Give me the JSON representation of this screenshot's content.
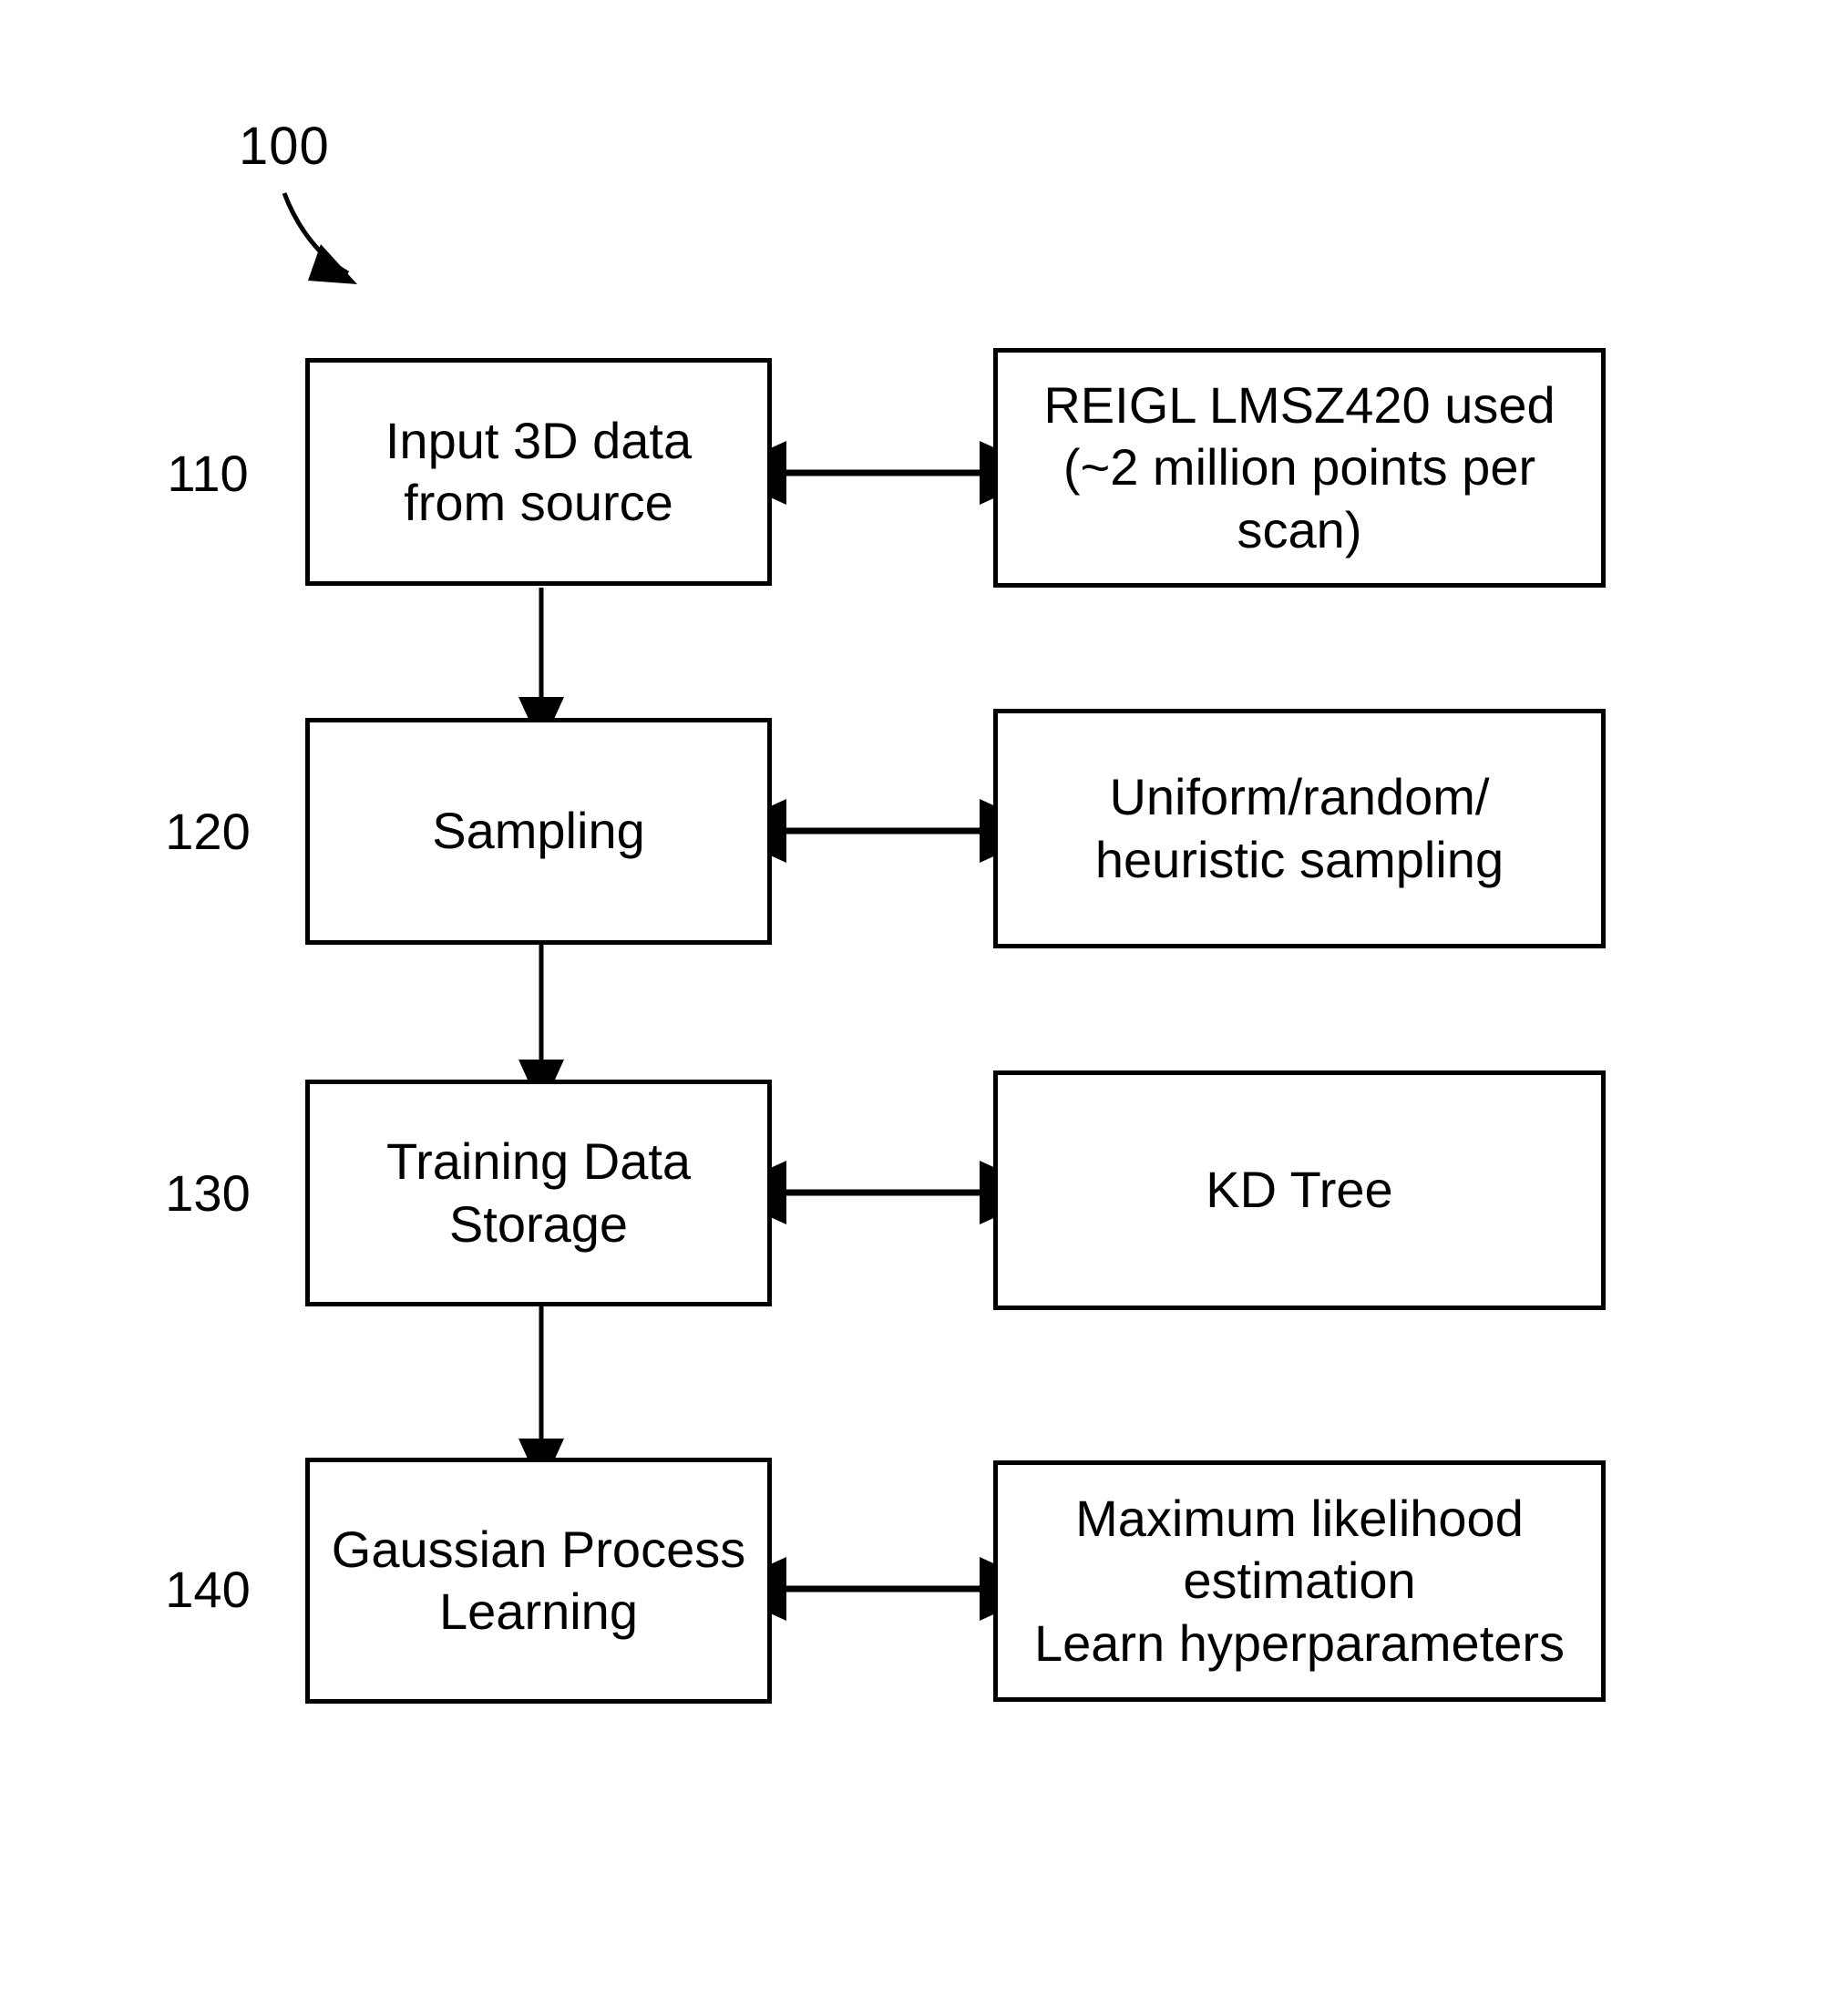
{
  "figure": {
    "reference_numeral": "100",
    "title": ""
  },
  "steps": [
    {
      "number": "110",
      "box_label": "Input 3D data\nfrom source",
      "detail_label": "REIGL LMSZ420 used\n(~2 million points per\nscan)",
      "connector": "double-headed-arrow"
    },
    {
      "number": "120",
      "box_label": "Sampling",
      "detail_label": "Uniform/random/\nheuristic sampling",
      "connector": "double-headed-arrow"
    },
    {
      "number": "130",
      "box_label": "Training Data\nStorage",
      "detail_label": "KD Tree",
      "connector": "double-headed-arrow"
    },
    {
      "number": "140",
      "box_label": "Gaussian Process\nLearning",
      "detail_label": "Maximum likelihood\nestimation\nLearn hyperparameters",
      "connector": "double-headed-arrow"
    }
  ],
  "flow_arrows": [
    {
      "from": "110",
      "to": "120"
    },
    {
      "from": "120",
      "to": "130"
    },
    {
      "from": "130",
      "to": "140"
    }
  ],
  "colors": {
    "stroke": "#000000",
    "background": "#ffffff"
  }
}
